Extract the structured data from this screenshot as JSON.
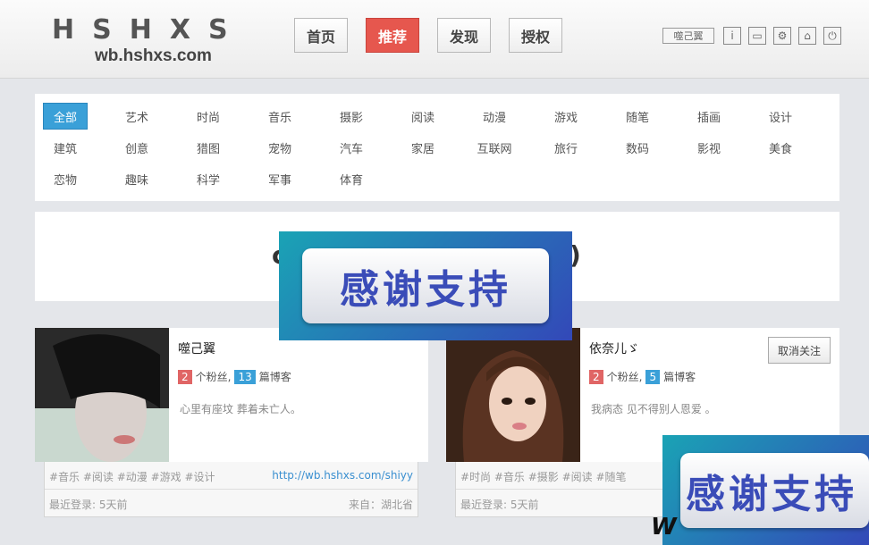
{
  "header": {
    "logo_title": "HSHXS",
    "logo_url": "wb.hshxs.com",
    "nav": [
      "首页",
      "推荐",
      "发现",
      "授权"
    ],
    "user_name": "噬己翼",
    "tools": [
      {
        "name": "info-icon",
        "glyph": "i"
      },
      {
        "name": "message-icon",
        "glyph": "▭"
      },
      {
        "name": "gear-icon",
        "glyph": "⚙"
      },
      {
        "name": "home-icon",
        "glyph": "⌂"
      },
      {
        "name": "power-icon",
        "glyph": "⏻"
      }
    ]
  },
  "categories": {
    "active": "全部",
    "items": [
      "全部",
      "艺术",
      "时尚",
      "音乐",
      "摄影",
      "阅读",
      "动漫",
      "游戏",
      "随笔",
      "插画",
      "设计",
      "建筑",
      "创意",
      "猎图",
      "宠物",
      "汽车",
      "家居",
      "互联网",
      "旅行",
      "数码",
      "影视",
      "美食",
      "恋物",
      "趣味",
      "科学",
      "军事",
      "体育"
    ]
  },
  "banner": {
    "partial_left": "c",
    "partial_right": ")"
  },
  "promo": {
    "text": "感谢支持",
    "colors": {
      "from": "#1aa3b5",
      "to": "#3348b8",
      "text": "#3a4cb8"
    }
  },
  "users": [
    {
      "name": "噬己翼",
      "fans": "2",
      "fans_label": "个粉丝,",
      "blogs": "13",
      "blogs_label": "篇博客",
      "bio": "心里有座坟 葬着未亡人。",
      "tags": "#音乐 #阅读 #动漫 #游戏 #设计",
      "link": "http://wb.hshxs.com/shiyy",
      "last_login": "最近登录: 5天前",
      "origin": "来自：湖北省"
    },
    {
      "name": "依奈儿ゞ",
      "fans": "2",
      "fans_label": "个粉丝,",
      "blogs": "5",
      "blogs_label": "篇博客",
      "bio": "我病态 见不得别人恩爱 。",
      "unfollow": "取消关注",
      "tags": "#时尚 #音乐 #摄影 #阅读 #随笔",
      "last_login": "最近登录: 5天前"
    }
  ],
  "watermark": "W"
}
